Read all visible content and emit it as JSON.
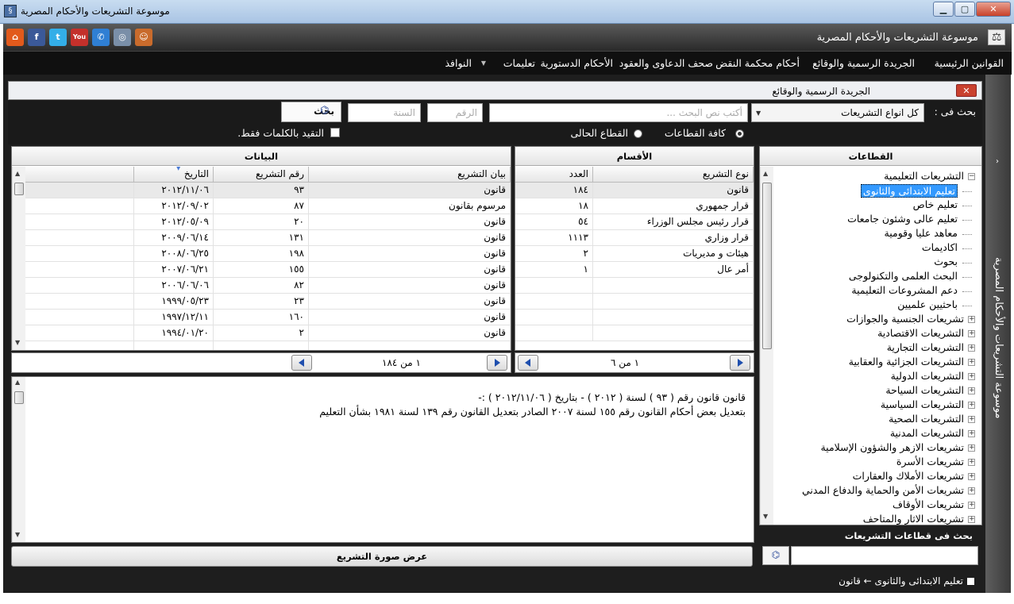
{
  "window": {
    "title": "موسوعة التشريعات والأحكام المصرية",
    "min": "▁",
    "max": "▢",
    "close": "✕"
  },
  "toolbar": {
    "app_name": "موسوعة التشريعات والأحكام المصرية",
    "icons": [
      "home-icon",
      "facebook-icon",
      "twitter-icon",
      "youtube-icon",
      "phone-icon",
      "globe-icon",
      "user-icon"
    ]
  },
  "menu": {
    "items": [
      "القوانين الرئيسية",
      "الجريدة الرسمية والوقائع",
      "أحكام محكمة النقض",
      "صحف الدعاوى والعقود",
      "الأحكام الدستورية",
      "تعليمات",
      "النوافذ"
    ]
  },
  "side_label": "موسوعة التشريعات والأحكام المصرية",
  "panel": {
    "title": "الجريدة الرسمية والوقائع",
    "close": "✕"
  },
  "search": {
    "label": "بحث فى :",
    "type_value": "كل انواع التشريعات",
    "text_placeholder": "أكتب نص البحث ...",
    "number_placeholder": "الرقم",
    "year_placeholder": "السنة",
    "button": "بحث",
    "radio_all": "كافة القطاعات",
    "radio_current": "القطاع الحالى",
    "checkbox": "التقيد بالكلمات فقط."
  },
  "sectors": {
    "header": "القطاعات",
    "tree": [
      {
        "label": "التشريعات التعليمية",
        "expanded": true,
        "children": [
          "تعليم الابتدائى والثانوى",
          "تعليم خاص",
          "تعليم عالى وشئون جامعات",
          "معاهد عليا وقومية",
          "اكاديمات",
          "بحوث",
          "البحث العلمى والتكنولوجى",
          "دعم المشروعات التعليمية",
          "باحثيين علميين"
        ]
      },
      {
        "label": "تشريعات الجنسية والجوازات"
      },
      {
        "label": "التشريعات الاقتصادية"
      },
      {
        "label": "التشريعات التجارية"
      },
      {
        "label": "التشريعات الجزائية والعقابية"
      },
      {
        "label": "التشريعات الدولية"
      },
      {
        "label": "التشريعات السياحة"
      },
      {
        "label": "التشريعات السياسية"
      },
      {
        "label": "التشريعات الصحية"
      },
      {
        "label": "التشريعات المدنية"
      },
      {
        "label": "تشريعات  الازهر والشؤون الإسلامية"
      },
      {
        "label": "تشريعات الأسرة"
      },
      {
        "label": "تشريعات الأملاك والعقارات"
      },
      {
        "label": "تشريعات الأمن والحماية والدفاع المدني"
      },
      {
        "label": "تشريعات الأوقاف"
      },
      {
        "label": "تشريعات الاثار والمتاحف"
      }
    ],
    "search_label": "بحث فى قطاعات التشريعات"
  },
  "sections": {
    "header": "الأقسام",
    "columns": [
      "نوع التشريع",
      "العدد"
    ],
    "rows": [
      [
        "قانون",
        "١٨٤"
      ],
      [
        "قرار جمهوري",
        "١٨"
      ],
      [
        "قرار رئيس مجلس الوزراء",
        "٥٤"
      ],
      [
        "قرار وزاري",
        "١١١٣"
      ],
      [
        "هيئات و مديريات",
        "٢"
      ],
      [
        "أمر عال",
        "١"
      ]
    ],
    "pager": "١ من ٦"
  },
  "data": {
    "header": "البيانات",
    "columns": [
      "بيان التشريع",
      "رقم التشريع",
      "التاريخ"
    ],
    "rows": [
      [
        "قانون",
        "٩٣",
        "٢٠١٢/١١/٠٦"
      ],
      [
        "مرسوم بقانون",
        "٨٧",
        "٢٠١٢/٠٩/٠٢"
      ],
      [
        "قانون",
        "٢٠",
        "٢٠١٢/٠٥/٠٩"
      ],
      [
        "قانون",
        "١٣١",
        "٢٠٠٩/٠٦/١٤"
      ],
      [
        "قانون",
        "١٩٨",
        "٢٠٠٨/٠٦/٢٥"
      ],
      [
        "قانون",
        "١٥٥",
        "٢٠٠٧/٠٦/٢١"
      ],
      [
        "قانون",
        "٨٢",
        "٢٠٠٦/٠٦/٠٦"
      ],
      [
        "قانون",
        "٢٣",
        "١٩٩٩/٠٥/٢٣"
      ],
      [
        "قانون",
        "١٦٠",
        "١٩٩٧/١٢/١١"
      ],
      [
        "قانون",
        "٢",
        "١٩٩٤/٠١/٢٠"
      ]
    ],
    "pager": "١ من ١٨٤"
  },
  "detail": {
    "line1": "قانون قانون رقم ( ٩٣ ) لسنة ( ٢٠١٢ ) - بتاريخ ( ٢٠١٢/١١/٠٦ ) :-",
    "line2": "بتعديل بعض أحكام القانون رقم ١٥٥ لسنة ٢٠٠٧ الصادر بتعديل القانون رقم ١٣٩ لسنة ١٩٨١ بشأن التعليم"
  },
  "view_image_button": "عرض صورة التشريع",
  "status": "تعليم الابتدائى والثانوى ← قانون"
}
